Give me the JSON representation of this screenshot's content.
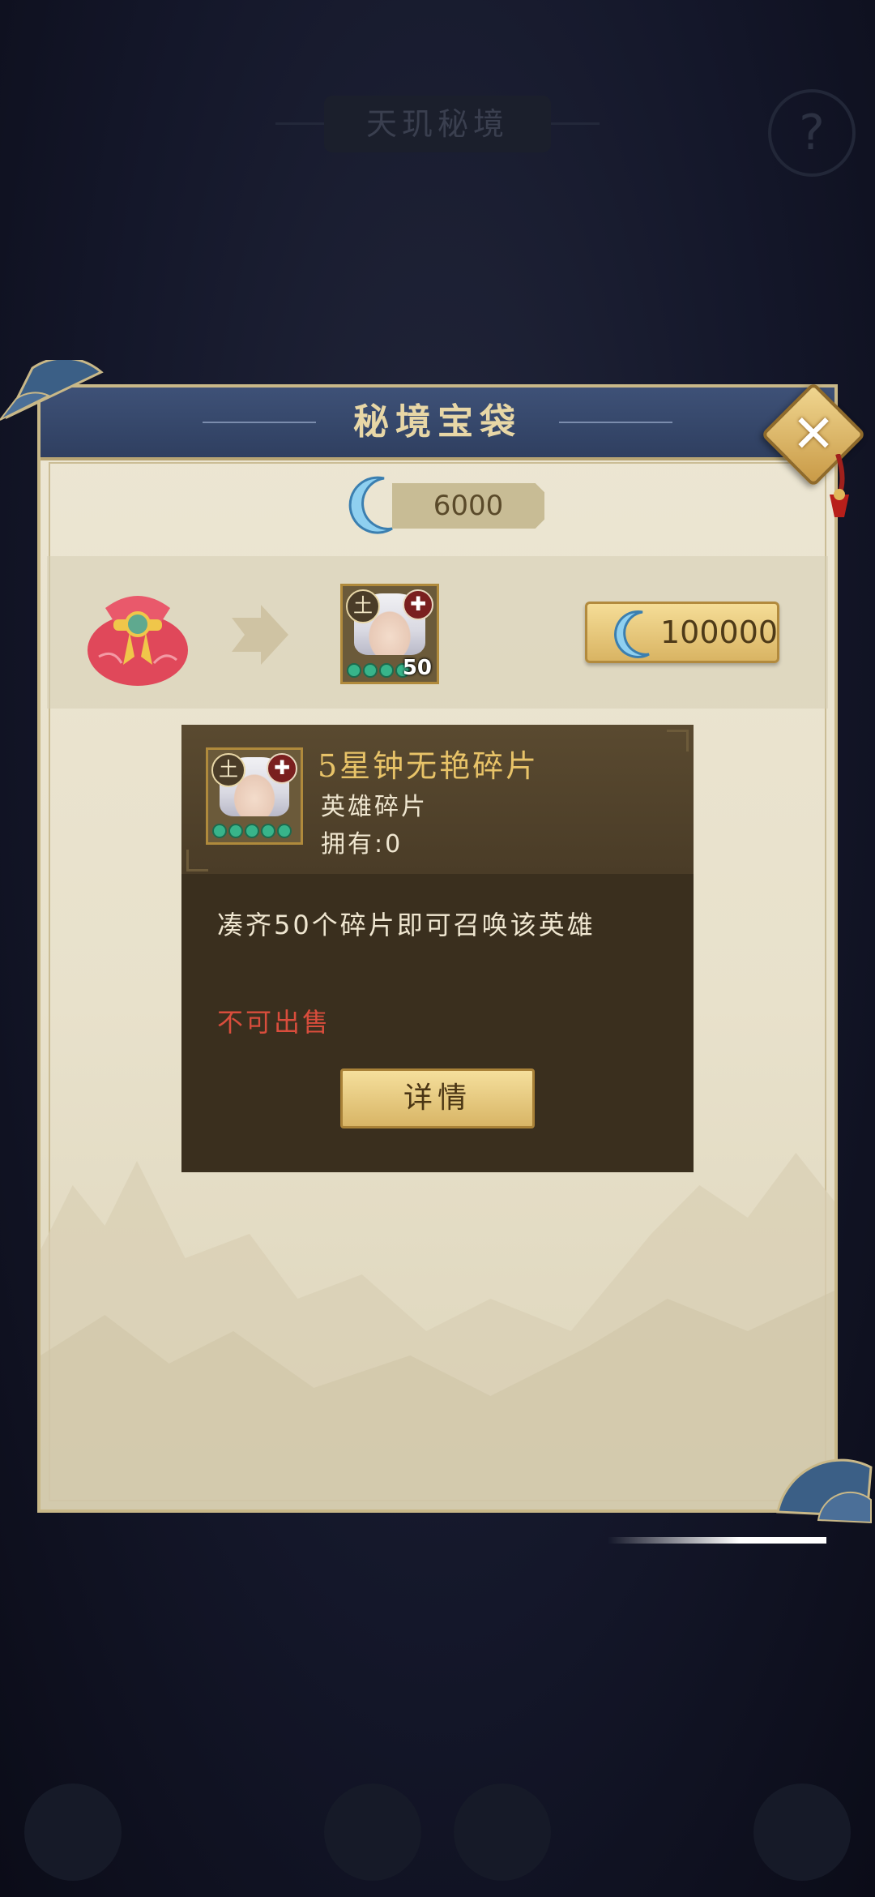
{
  "background": {
    "title": "天玑秘境",
    "help_icon": "?"
  },
  "panel": {
    "title": "秘境宝袋",
    "close_icon": "close-icon"
  },
  "currency": {
    "icon": "crescent-moon-icon",
    "amount": "6000"
  },
  "exchange": {
    "source_icon": "lucky-bag-icon",
    "arrow_icon": "arrow-right-icon",
    "reward": {
      "element_badge": "土",
      "role_badge": "heal-cross-icon",
      "count": "50",
      "stars": 4
    },
    "price": "100000"
  },
  "tooltip": {
    "name": "5星钟无艳碎片",
    "type": "英雄碎片",
    "owned": "拥有:0",
    "element_badge": "土",
    "stars": 5,
    "description": "凑齐50个碎片即可召唤该英雄",
    "sale_status": "不可出售",
    "detail_button": "详情"
  },
  "colors": {
    "accent_gold": "#e8c368",
    "warning_red": "#d94d3c",
    "header_blue": "#3e5177"
  }
}
